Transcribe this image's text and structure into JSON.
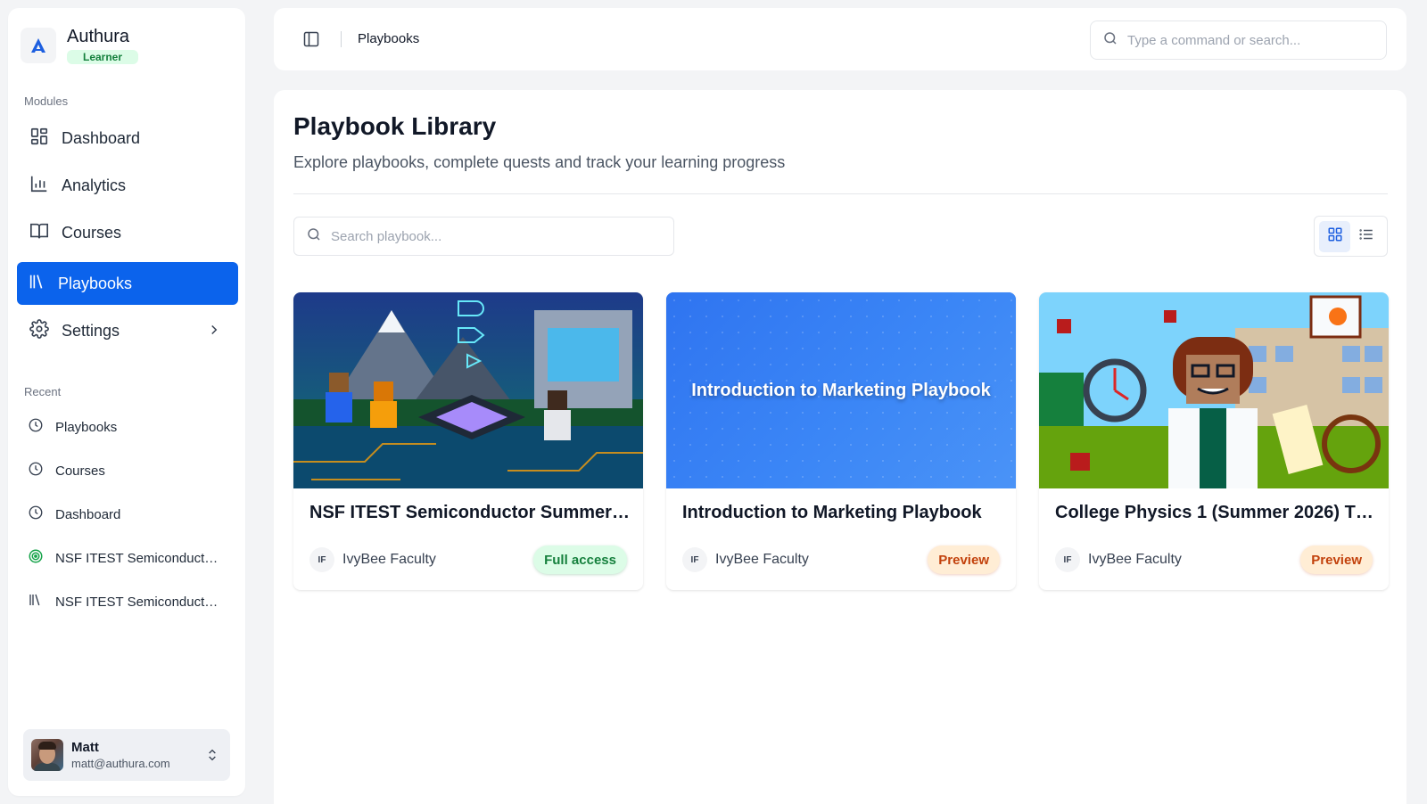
{
  "app": {
    "name": "Authura",
    "role_badge": "Learner"
  },
  "sidebar": {
    "modules_label": "Modules",
    "items": [
      {
        "label": "Dashboard",
        "icon": "layout-dashboard-icon"
      },
      {
        "label": "Analytics",
        "icon": "bar-chart-icon"
      },
      {
        "label": "Courses",
        "icon": "book-open-icon"
      },
      {
        "label": "Playbooks",
        "icon": "library-icon",
        "active": true
      },
      {
        "label": "Settings",
        "icon": "gear-icon",
        "has_submenu": true
      }
    ],
    "recent_label": "Recent",
    "recent": [
      {
        "label": "Playbooks",
        "icon": "clock-icon"
      },
      {
        "label": "Courses",
        "icon": "clock-icon"
      },
      {
        "label": "Dashboard",
        "icon": "clock-icon"
      },
      {
        "label": "NSF ITEST Semiconductor Summer Camp",
        "icon": "target-icon"
      },
      {
        "label": "NSF ITEST Semiconductor Summer Camp",
        "icon": "library-icon"
      }
    ]
  },
  "user": {
    "name": "Matt",
    "email": "matt@authura.com"
  },
  "header": {
    "breadcrumb": "Playbooks",
    "command_placeholder": "Type a command or search..."
  },
  "page": {
    "title": "Playbook Library",
    "subtitle": "Explore playbooks, complete quests and track your learning progress",
    "search_placeholder": "Search playbook..."
  },
  "playbooks": [
    {
      "title": "NSF ITEST Semiconductor Summer ...",
      "author_initials": "IF",
      "author": "IvyBee Faculty",
      "access": "Full access"
    },
    {
      "title": "Introduction to Marketing Playbook",
      "cover_text": "Introduction to Marketing Playbook",
      "author_initials": "IF",
      "author": "IvyBee Faculty",
      "access": "Preview"
    },
    {
      "title": "College Physics 1 (Summer 2026) TE...",
      "author_initials": "IF",
      "author": "IvyBee Faculty",
      "access": "Preview"
    }
  ],
  "colors": {
    "accent": "#0b63ec",
    "full_access": "#15803d",
    "preview": "#c2410c"
  }
}
